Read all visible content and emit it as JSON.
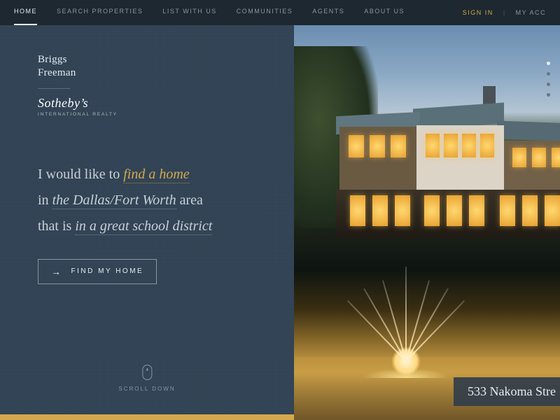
{
  "nav": {
    "items": [
      "HOME",
      "SEARCH PROPERTIES",
      "LIST WITH US",
      "COMMUNITIES",
      "AGENTS",
      "ABOUT US"
    ],
    "activeIndex": 0,
    "signin": "SIGN IN",
    "account": "MY ACC"
  },
  "brand": {
    "line1": "Briggs",
    "line2": "Freeman",
    "sothebys": "Sotheby’s",
    "sub": "INTERNATIONAL REALTY"
  },
  "sentence": {
    "pre1": "I would like to ",
    "slot1": "find a home",
    "pre2": "in ",
    "slot2": "the Dallas/Fort Worth",
    "post2": " area",
    "pre3": "that is ",
    "slot3": "in a great school district"
  },
  "cta": {
    "label": "FIND MY HOME"
  },
  "scroll": {
    "label": "SCROLL DOWN"
  },
  "hero": {
    "caption": "533 Nakoma Stre",
    "dotsCount": 4,
    "activeDot": 0
  },
  "colors": {
    "gold": "#d4a94e",
    "navy": "#2f4152"
  }
}
